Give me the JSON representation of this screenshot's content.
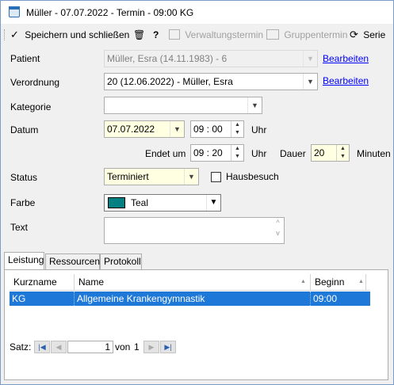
{
  "window": {
    "title": "Müller - 07.07.2022 - Termin - 09:00 KG"
  },
  "toolbar": {
    "save_close": "Speichern und schließen",
    "delete": "🗑",
    "help": "?",
    "admin_appointment": "Verwaltungstermin",
    "group_appointment": "Gruppentermin",
    "series": "Serie"
  },
  "form": {
    "patient_label": "Patient",
    "patient_value": "Müller, Esra (14.11.1983) - 6",
    "patient_edit": "Bearbeiten",
    "prescription_label": "Verordnung",
    "prescription_value": "20 (12.06.2022) - Müller, Esra",
    "prescription_edit": "Bearbeiten",
    "category_label": "Kategorie",
    "category_value": "",
    "date_label": "Datum",
    "date_value": "07.07.2022",
    "time_start": "09 : 00",
    "uhr1": "Uhr",
    "ends_label": "Endet um",
    "time_end": "09 : 20",
    "uhr2": "Uhr",
    "duration_label": "Dauer",
    "duration_value": "20",
    "minutes_label": "Minuten",
    "status_label": "Status",
    "status_value": "Terminiert",
    "home_visit_label": "Hausbesuch",
    "home_visit_checked": false,
    "color_label": "Farbe",
    "color_value": "Teal",
    "color_hex": "#008080",
    "text_label": "Text",
    "text_value": ""
  },
  "tabs": [
    "Leistung",
    "Ressourcen",
    "Protokoll"
  ],
  "grid": {
    "columns": [
      "Kurzname",
      "Name",
      "Beginn"
    ],
    "rows": [
      {
        "kurzname": "KG",
        "name": "Allgemeine Krankengymnastik",
        "beginn": "09:00"
      }
    ]
  },
  "pager": {
    "label": "Satz:",
    "current": "1",
    "of_label": "von",
    "total": "1"
  }
}
